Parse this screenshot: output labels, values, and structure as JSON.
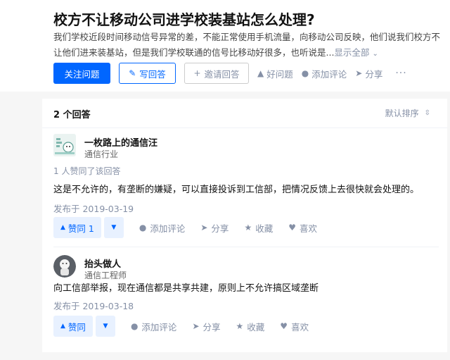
{
  "question": {
    "title": "校方不让移动公司进学校装基站怎么处理?",
    "description": "我们学校近段时间移动信号异常的差，不能正常使用手机流量，向移动公司反映，他们说我们校方不让他们进来装基站，但是我们学校联通的信号比移动好很多，也听说是...",
    "show_all": "显示全部",
    "actions": {
      "follow": "关注问题",
      "write": "写回答",
      "invite": "邀请回答",
      "good_question": "好问题",
      "add_comment": "添加评论",
      "share": "分享",
      "more": "···"
    }
  },
  "answers_header": {
    "count": "2 个回答",
    "sort": "默认排序"
  },
  "answers": [
    {
      "author": "一枚路上的通信汪",
      "bio": "通信行业",
      "upvote_info": "1 人赞同了该回答",
      "content": "这是不允许的，有垄断的嫌疑，可以直接投诉到工信部，把情况反馈上去很快就会处理的。",
      "date": "发布于 2019-03-19",
      "vote_label": "赞同 1",
      "comment": "添加评论",
      "share": "分享",
      "collect": "收藏",
      "like": "喜欢"
    },
    {
      "author": "抬头做人",
      "bio": "通信工程师",
      "content": "向工信部举报，现在通信都是共享共建，原则上不允许搞区域垄断",
      "date": "发布于 2019-03-18",
      "vote_label": "赞同",
      "comment": "添加评论",
      "share": "分享",
      "collect": "收藏",
      "like": "喜欢"
    }
  ],
  "colors": {
    "brand": "#0066ff",
    "muted": "#8590a6",
    "vote_bg": "#e8f1ff"
  }
}
